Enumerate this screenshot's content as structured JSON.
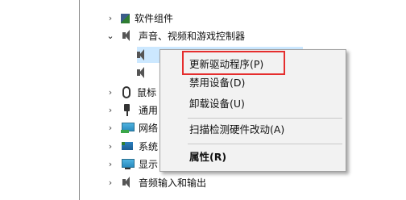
{
  "tree": {
    "items": [
      {
        "label": "软件组件",
        "expanded": false,
        "icon": "component-icon"
      },
      {
        "label": "声音、视频和游戏控制器",
        "expanded": true,
        "icon": "speaker-icon"
      },
      {
        "label": "",
        "icon": "speaker-icon",
        "selected": true
      },
      {
        "label": "",
        "icon": "speaker-icon"
      },
      {
        "label": "鼠标",
        "expanded": false,
        "icon": "mouse-icon"
      },
      {
        "label": "通用",
        "expanded": false,
        "icon": "usb-plug-icon"
      },
      {
        "label": "网络",
        "expanded": false,
        "icon": "network-monitor-icon"
      },
      {
        "label": "系统",
        "expanded": false,
        "icon": "system-icon"
      },
      {
        "label": "显示",
        "expanded": false,
        "icon": "display-icon"
      },
      {
        "label": "音频输入和输出",
        "expanded": false,
        "icon": "speaker-icon"
      }
    ]
  },
  "context_menu": {
    "items": [
      {
        "label": "更新驱动程序(P)",
        "highlighted": true
      },
      {
        "label": "禁用设备(D)"
      },
      {
        "label": "卸载设备(U)"
      },
      {
        "label": "扫描检测硬件改动(A)"
      },
      {
        "label": "属性(R)",
        "bold": true
      }
    ]
  },
  "colors": {
    "highlight_border": "#e52e2e",
    "selection": "#cce8ff"
  }
}
